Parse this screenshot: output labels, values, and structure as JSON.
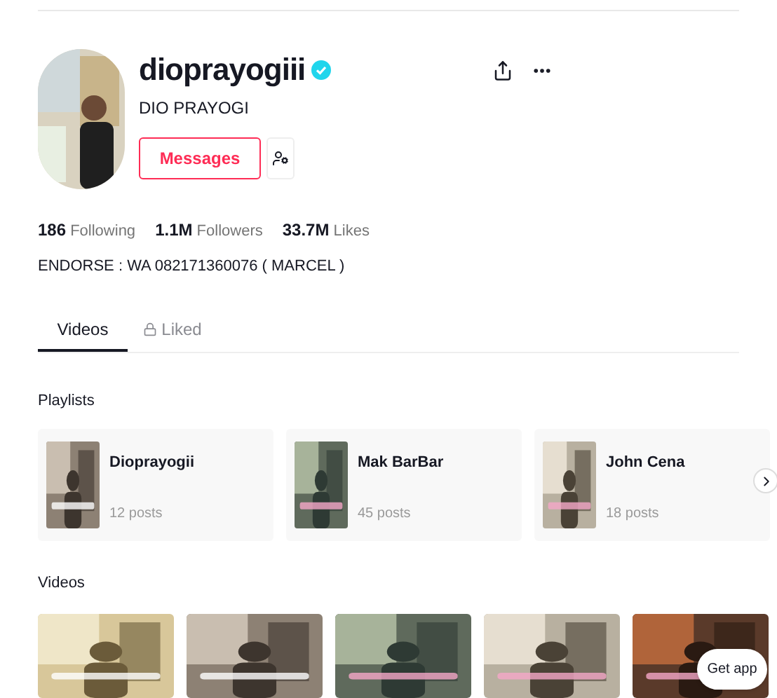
{
  "profile": {
    "username": "dioprayogiii",
    "verified": true,
    "display_name": "DIO PRAYOGI",
    "message_button": "Messages"
  },
  "stats": [
    "**186** Following",
    "**1.1M** Followers",
    "**33.7M** Likes"
  ],
  "bio": "ENDORSE : WA 082171360076 ( MARCEL )",
  "tabs": [
    {
      "label": "Videos",
      "selected": true,
      "locked": false
    },
    {
      "label": "Liked",
      "selected": false,
      "locked": true
    }
  ],
  "playlists": {
    "heading": "Playlists",
    "items": [
      {
        "title": "Dioprayogii",
        "count": "12 posts"
      },
      {
        "title": "Mak BarBar",
        "count": "45 posts"
      },
      {
        "title": "John Cena",
        "count": "18 posts"
      }
    ]
  },
  "videos": {
    "heading": "Videos"
  },
  "get_app": "Get app"
}
